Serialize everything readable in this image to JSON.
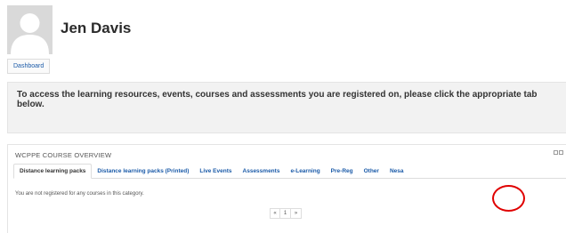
{
  "user": {
    "name": "Jen Davis",
    "avatar_icon": "user-silhouette-icon"
  },
  "breadcrumb": {
    "items": [
      "Dashboard"
    ]
  },
  "notice": {
    "text": "To access the learning resources, events, courses and assessments you are registered on, please click the appropriate tab below."
  },
  "course_overview": {
    "title": "WCPPE COURSE OVERVIEW",
    "controls": [
      "collapse-icon",
      "dock-icon"
    ],
    "tabs": [
      {
        "label": "Distance learning packs",
        "active": true
      },
      {
        "label": "Distance learning packs (Printed)",
        "active": false
      },
      {
        "label": "Live Events",
        "active": false
      },
      {
        "label": "Assessments",
        "active": false
      },
      {
        "label": "e-Learning",
        "active": false
      },
      {
        "label": "Pre-Reg",
        "active": false
      },
      {
        "label": "Other",
        "active": false
      },
      {
        "label": "Nesa",
        "active": false
      }
    ],
    "empty_message": "You are not registered for any courses in this category.",
    "pager": {
      "prev": "«",
      "current": "1",
      "next": "»"
    }
  },
  "colors": {
    "link": "#1a5aa8",
    "annotation": "#e00000",
    "notice_bg": "#f2f2f2"
  }
}
